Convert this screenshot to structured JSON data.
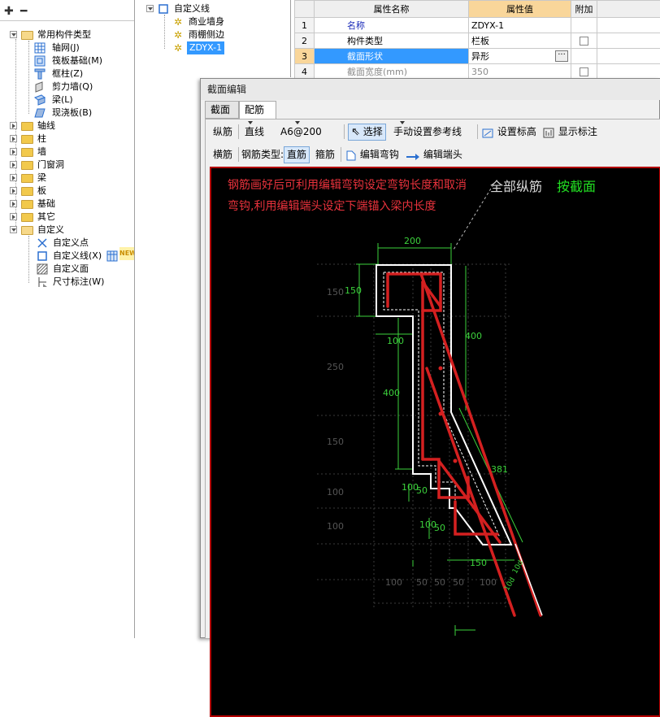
{
  "left_tree": {
    "items": [
      {
        "label": "常用构件类型"
      },
      {
        "label": "轴网(J)"
      },
      {
        "label": "筏板基础(M)"
      },
      {
        "label": "框柱(Z)"
      },
      {
        "label": "剪力墙(Q)"
      },
      {
        "label": "梁(L)"
      },
      {
        "label": "现浇板(B)"
      },
      {
        "label": "轴线"
      },
      {
        "label": "柱"
      },
      {
        "label": "墙"
      },
      {
        "label": "门窗洞"
      },
      {
        "label": "梁"
      },
      {
        "label": "板"
      },
      {
        "label": "基础"
      },
      {
        "label": "其它"
      },
      {
        "label": "自定义"
      },
      {
        "label": "自定义点"
      },
      {
        "label": "自定义线(X)"
      },
      {
        "label": "自定义面"
      },
      {
        "label": "尺寸标注(W)"
      }
    ],
    "new_badge": "NEW"
  },
  "mid_tree": {
    "root": "自定义线",
    "children": [
      "商业墙身",
      "雨棚侧边",
      "ZDYX-1"
    ]
  },
  "properties": {
    "headers": {
      "name": "属性名称",
      "value": "属性值",
      "extra": "附加"
    },
    "rows": [
      {
        "idx": "1",
        "name": "名称",
        "value": "ZDYX-1"
      },
      {
        "idx": "2",
        "name": "构件类型",
        "value": "栏板"
      },
      {
        "idx": "3",
        "name": "截面形状",
        "value": "异形"
      },
      {
        "idx": "4",
        "name": "截面宽度(mm)",
        "value": "350"
      }
    ]
  },
  "dialog": {
    "title": "截面编辑",
    "tabs": [
      "截面",
      "配筋"
    ],
    "toolbar1": {
      "longitudinal": "纵筋",
      "line_type": "直线",
      "spec": "A6@200",
      "select": "选择",
      "ref_line": "手动设置参考线",
      "set_elevation": "设置标高",
      "show_annotation": "显示标注"
    },
    "toolbar2": {
      "transverse": "横筋",
      "rebar_type_label": "钢筋类型:",
      "straight": "直筋",
      "stirrup": "箍筋",
      "edit_hook": "编辑弯钩",
      "edit_end": "编辑端头"
    }
  },
  "canvas": {
    "note_line1": "钢筋画好后可利用编辑弯钩设定弯钩长度和取消",
    "note_line2": "弯钩,利用编辑端头设定下端锚入梁内长度",
    "all_longitudinal": "全部纵筋",
    "by_section": "按截面",
    "dims": {
      "top_width": "200",
      "left_150": "150",
      "right_400": "400",
      "mid_100": "100",
      "left_400": "400",
      "diag_381": "381",
      "step_100_a": "100",
      "step_50_a": "50",
      "step_100_b": "100",
      "step_50_b": "50",
      "bottom_150": "150",
      "grid_150_a": "150",
      "grid_250": "250",
      "grid_150_b": "150",
      "grid_100_a": "100",
      "grid_100_b": "100",
      "bottom_100_a": "100",
      "bottom_50_a": "50",
      "bottom_50_b": "50",
      "bottom_50_c": "50",
      "bottom_100_b": "100",
      "anchor_a": "10d",
      "anchor_b": "10d"
    }
  },
  "colors": {
    "selection": "#3399ff",
    "value_header": "#f9d69a",
    "rebar": "#d42020",
    "canvas_bg": "#000000",
    "dim_green": "#3cd23c"
  }
}
